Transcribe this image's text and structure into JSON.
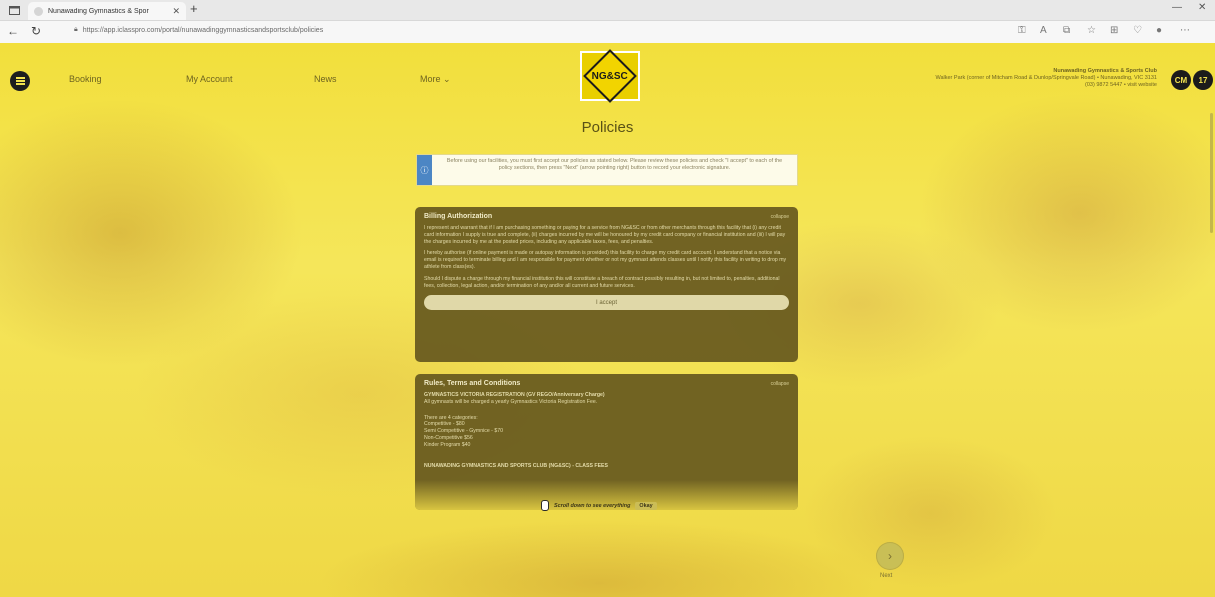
{
  "browser": {
    "tab_title": "Nunawading Gymnastics & Spor",
    "url": "https://app.iclasspro.com/portal/nunawadinggymnasticsandsportsclub/policies",
    "window_controls": {
      "minimize": "—",
      "close": "✕"
    }
  },
  "nav": {
    "links": [
      "Booking",
      "My Account",
      "News",
      "More ⌄"
    ]
  },
  "logo": {
    "text": "NG&SC"
  },
  "club": {
    "name": "Nunawading Gymnastics & Sports Club",
    "address": "Walker Park (corner of Mitcham Road & Dunlop/Springvale Road) • Nunawading, VIC 3131",
    "phone": "(03) 9872 5447 • visit website"
  },
  "user": {
    "initials": "CM",
    "cart_count": "17"
  },
  "page": {
    "title": "Policies"
  },
  "info": {
    "text": "Before using our facilities, you must first accept our policies as stated below. Please review these policies and check \"I accept\" to each of the policy sections, then press \"Next\" (arrow pointing right) button to record your electronic signature."
  },
  "billing": {
    "title": "Billing Authorization",
    "collapse_label": "collapse",
    "paragraphs": [
      "I represent and warrant that if I am purchasing something or paying for a service from NG&SC or from other merchants through this facility that (i) any credit card information I supply is true and complete, (ii) charges incurred by me will be honoured by my credit card company or financial institution and (iii) I will pay the charges incurred by me at the posted prices, including any applicable taxes, fees, and penalties.",
      "I hereby authorise (if online payment is made or autopay information is provided) this facility to charge my credit card account. I understand that a notice via email is required to terminate billing and I am responsible for payment whether or not my gymnast attends classes until I notify this facility in writing to drop my athlete from class(es).",
      "Should I dispute a charge through my financial institution this will constitute a breach of contract possibly resulting in, but not limited to, penalties, additional fees, collection, legal action, and/or termination of any and/or all current and future services."
    ],
    "accept_label": "I accept"
  },
  "rules": {
    "title": "Rules, Terms and Conditions",
    "collapse_label": "collapse",
    "section1_heading": "GYMNASTICS VICTORIA REGISTRATION (GV REGO/Anniversary Charge)",
    "section1_intro": "All gymnasts will be charged a yearly Gymnastics Victoria Registration Fee.",
    "categories_intro": "There are 4 categories:",
    "categories": [
      "Competitive - $80",
      "Semi Competitive - Gymnice - $70",
      "Non-Competitive $56",
      "Kinder Program $40"
    ],
    "section2_heading": "NUNAWADING GYMNASTICS AND SPORTS CLUB (NG&SC) - CLASS FEES"
  },
  "scroll_hint": {
    "text": "Scroll down to see everything",
    "button": "Okay"
  },
  "next": {
    "label": "Next",
    "icon": "arrow-right-icon"
  },
  "colors": {
    "accent": "#f3e34f",
    "card_bg": "#66581e",
    "info_blue": "#4c86c4",
    "dark": "#1b1b1b"
  }
}
